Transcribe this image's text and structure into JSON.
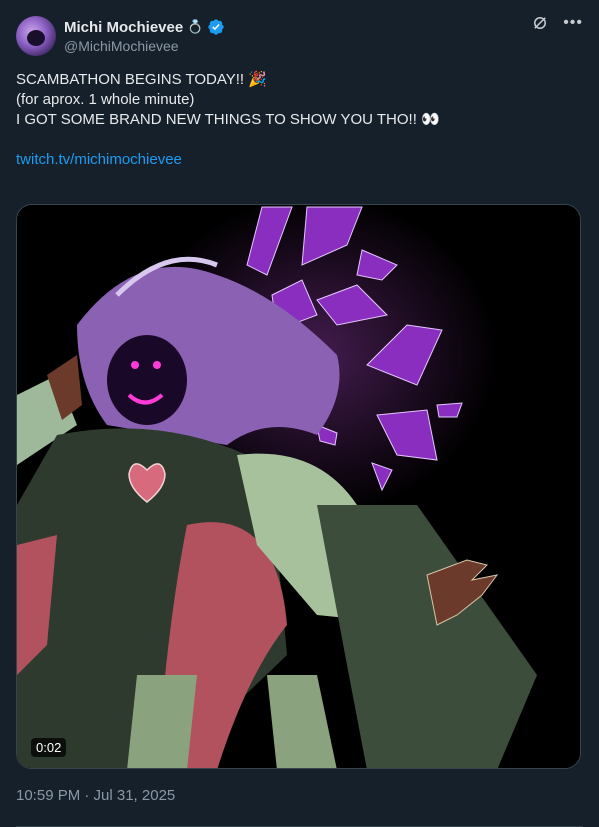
{
  "author": {
    "display_name": "Michi Mochievee",
    "name_emoji": "💍",
    "handle": "@MichiMochievee",
    "avatar_icon": "avatar-icon",
    "verified_color": "#1d9bf0"
  },
  "tweet": {
    "line1": "SCAMBATHON BEGINS TODAY!! 🎉",
    "line2": "(for aprox. 1 whole minute)",
    "line3": "I GOT SOME BRAND NEW THINGS TO SHOW YOU THO!! 👀",
    "link": "twitch.tv/michimochievee",
    "timestamp": "10:59 PM · Jul 31, 2025"
  },
  "media": {
    "type": "video",
    "duration": "0:02"
  },
  "colors": {
    "background": "#15202b",
    "text": "#e7e9ea",
    "secondary": "#8b98a5",
    "link": "#1d9bf0",
    "border": "#38444d"
  }
}
